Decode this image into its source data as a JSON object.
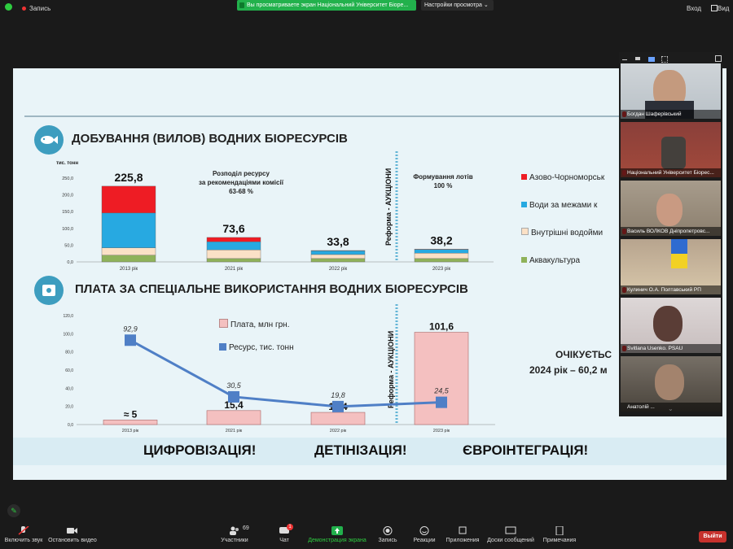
{
  "topbar": {
    "recording": "Запись",
    "share_banner": "Вы просматриваете экран Національний Університет Біоре...",
    "view_options": "Настройки просмотра",
    "sign_in": "Вход",
    "view": "Вид"
  },
  "slide": {
    "section1_title": "ДОБУВАННЯ (ВИЛОВ) ВОДНИХ БІОРЕСУРСІВ",
    "section2_title": "ПЛАТА ЗА СПЕЦІАЛЬНЕ ВИКОРИСТАННЯ ВОДНИХ БІОРЕСУРСІВ",
    "distribution_note": [
      "Розподіл ресурсу",
      "за рекомендаціями комісії",
      "63-68 %"
    ],
    "lots_note": [
      "Формування лотів",
      "100 %"
    ],
    "reform_label": "Реформа - АУКЦІОНИ",
    "expected": [
      "ОЧІКУЄТЬС",
      "2024 рік – 60,2 м"
    ],
    "bottom_banner": [
      "ЦИФРОВІЗАЦІЯ!",
      "ДЕТІНІЗАЦІЯ!",
      "ЄВРОІНТЕГРАЦІЯ!"
    ]
  },
  "chart_data": [
    {
      "type": "bar",
      "ylabel": "тис. тонн",
      "ylim": [
        0,
        250
      ],
      "yticks": [
        "0,0",
        "50,0",
        "100,0",
        "150,0",
        "200,0",
        "250,0"
      ],
      "categories": [
        "2013 рік",
        "2021 рік",
        "2022 рік",
        "2023 рік"
      ],
      "totals": [
        "225,8",
        "73,6",
        "33,8",
        "38,2"
      ],
      "series": [
        {
          "name": "Аквакультура",
          "color": "#8fb25a",
          "values": [
            20,
            10,
            10,
            10
          ]
        },
        {
          "name": "Внутрішні водойми",
          "color": "#fbe1c6",
          "values": [
            22,
            26,
            12,
            16
          ]
        },
        {
          "name": "Води за межами к",
          "color": "#27a9e1",
          "values": [
            104,
            24,
            11,
            11
          ]
        },
        {
          "name": "Азово-Чорноморськ",
          "color": "#ee1c24",
          "values": [
            80,
            13,
            1,
            1
          ]
        }
      ]
    },
    {
      "type": "bar+line",
      "ylim": [
        0,
        120
      ],
      "yticks": [
        "0,0",
        "20,0",
        "40,0",
        "60,0",
        "80,0",
        "100,0",
        "120,0"
      ],
      "categories": [
        "2013 рік",
        "2021 рік",
        "2022 рік",
        "2023 рік"
      ],
      "bar_series": {
        "name": "Плата, млн грн.",
        "color": "#f4c0c0",
        "values": [
          5,
          15.4,
          13.4,
          101.6
        ],
        "labels": [
          "≈ 5",
          "15,4",
          "13,4",
          "101,6"
        ]
      },
      "line_series": {
        "name": "Ресурс, тис. тонн",
        "color": "#4f7fc6",
        "values": [
          92.9,
          30.5,
          19.8,
          24.5
        ],
        "labels": [
          "92,9",
          "30,5",
          "19,8",
          "24,5"
        ]
      }
    }
  ],
  "participants": [
    "Богдан Шаферівський",
    "Національний Університет Біорес...",
    "Василь ВОЛКОВ Дніпропетровс...",
    "Кулинич О.А. Полтавський РП",
    "Svitlana Usenko. PSAU",
    "Анатолій ..."
  ],
  "bottombar": {
    "mute": "Включить звук",
    "video": "Остановить видео",
    "participants": "Участники",
    "participants_count": "69",
    "chat": "Чат",
    "chat_badge": "1",
    "share": "Демонстрация экрана",
    "record": "Запись",
    "reactions": "Реакции",
    "apps": "Приложения",
    "whiteboard": "Доски сообщений",
    "notes": "Примечания",
    "leave": "Выйти"
  }
}
